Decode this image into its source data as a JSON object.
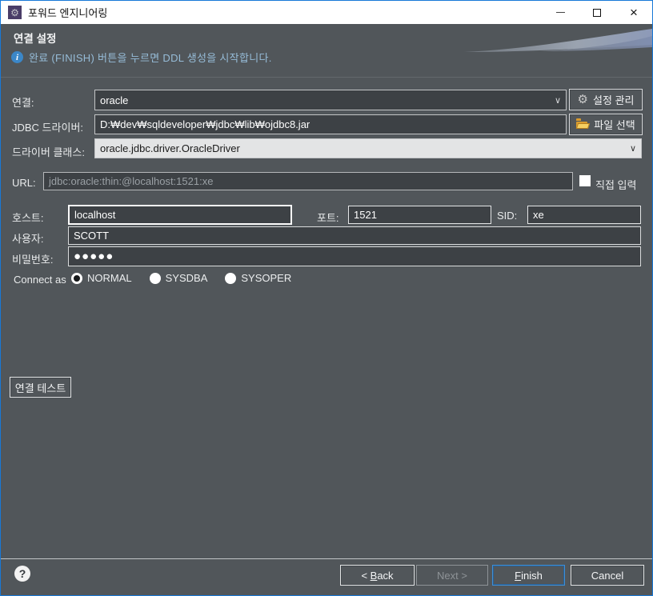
{
  "window": {
    "title": "포워드 엔지니어링",
    "controls": {
      "minimize": "",
      "maximize": "",
      "close": "×"
    },
    "app_icon_glyph": "⚙"
  },
  "header": {
    "title": "연결 설정",
    "info_icon_glyph": "i",
    "message": "완료 (FINISH) 버튼을 누르면 DDL 생성을 시작합니다."
  },
  "icons": {
    "chevron_down": "∨",
    "gear": "⚙"
  },
  "form": {
    "connection": {
      "label": "연결:",
      "value": "oracle",
      "manage_button": "설정 관리"
    },
    "jdbc_driver": {
      "label": "JDBC 드라이버:",
      "value": "D:₩dev₩sqldeveloper₩jdbc₩lib₩ojdbc8.jar",
      "file_button": "파일 선택"
    },
    "driver_class": {
      "label": "드라이버 클래스:",
      "value": "oracle.jdbc.driver.OracleDriver"
    },
    "url": {
      "label": "URL:",
      "value": "jdbc:oracle:thin:@localhost:1521:xe",
      "direct_input_label": "직접 입력",
      "direct_input_checked": false
    },
    "host": {
      "label": "호스트:",
      "value": "localhost"
    },
    "port": {
      "label": "포트:",
      "value": "1521"
    },
    "sid": {
      "label": "SID:",
      "value": "xe"
    },
    "user": {
      "label": "사용자:",
      "value": "SCOTT"
    },
    "password": {
      "label": "비밀번호:",
      "value": "●●●●●"
    },
    "connect_as": {
      "label": "Connect as",
      "option_normal": {
        "label": "NORMAL",
        "selected": true
      },
      "option_sysdba": {
        "label": "SYSDBA",
        "selected": false
      },
      "option_sysoper": {
        "label": "SYSOPER",
        "selected": false
      }
    },
    "test_button": "연결 테스트"
  },
  "footer": {
    "help": "?",
    "back": {
      "pre": "< ",
      "key": "B",
      "rest": "ack"
    },
    "next": {
      "label": "Next >",
      "enabled": false
    },
    "finish": {
      "key": "F",
      "rest": "inish"
    },
    "cancel": "Cancel"
  }
}
